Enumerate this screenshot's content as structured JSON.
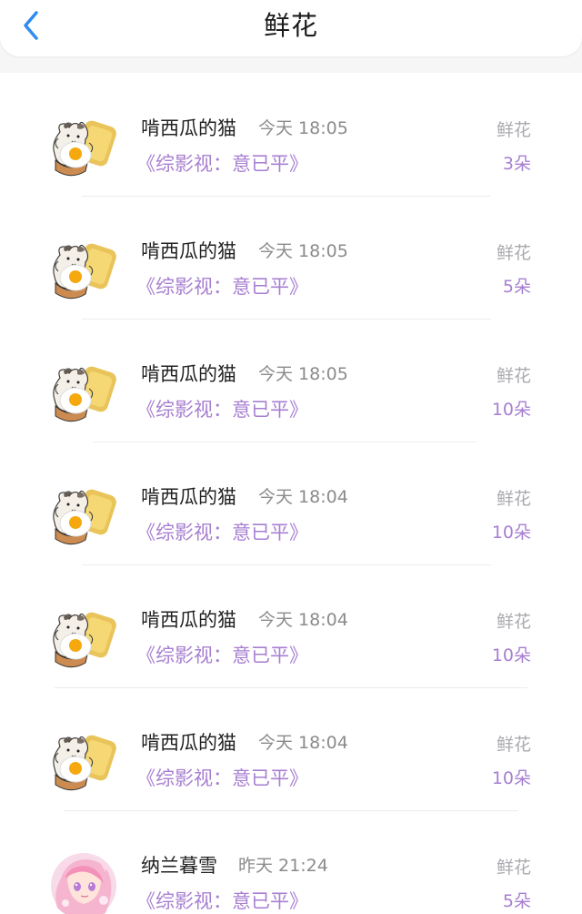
{
  "header": {
    "title": "鲜花",
    "back_icon": "chevron-left-icon",
    "accent_color": "#2f8cf0"
  },
  "colors": {
    "purple": "#a77fd1",
    "gray": "#8b8b8b",
    "light_gray": "#aaa9af"
  },
  "records": [
    {
      "user": "啃西瓜的猫",
      "time": "今天 18:05",
      "book": "《综影视：意已平》",
      "gift": "鲜花",
      "count": "3朵",
      "avatar": "cat-egg-toast-avatar"
    },
    {
      "user": "啃西瓜的猫",
      "time": "今天 18:05",
      "book": "《综影视：意已平》",
      "gift": "鲜花",
      "count": "5朵",
      "avatar": "cat-egg-toast-avatar"
    },
    {
      "user": "啃西瓜的猫",
      "time": "今天 18:05",
      "book": "《综影视：意已平》",
      "gift": "鲜花",
      "count": "10朵",
      "avatar": "cat-egg-toast-avatar"
    },
    {
      "user": "啃西瓜的猫",
      "time": "今天 18:04",
      "book": "《综影视：意已平》",
      "gift": "鲜花",
      "count": "10朵",
      "avatar": "cat-egg-toast-avatar"
    },
    {
      "user": "啃西瓜的猫",
      "time": "今天 18:04",
      "book": "《综影视：意已平》",
      "gift": "鲜花",
      "count": "10朵",
      "avatar": "cat-egg-toast-avatar"
    },
    {
      "user": "啃西瓜的猫",
      "time": "今天 18:04",
      "book": "《综影视：意已平》",
      "gift": "鲜花",
      "count": "10朵",
      "avatar": "cat-egg-toast-avatar"
    },
    {
      "user": "纳兰暮雪",
      "time": "昨天 21:24",
      "book": "《综影视：意已平》",
      "gift": "鲜花",
      "count": "5朵",
      "avatar": "pink-anime-girl-avatar"
    }
  ]
}
